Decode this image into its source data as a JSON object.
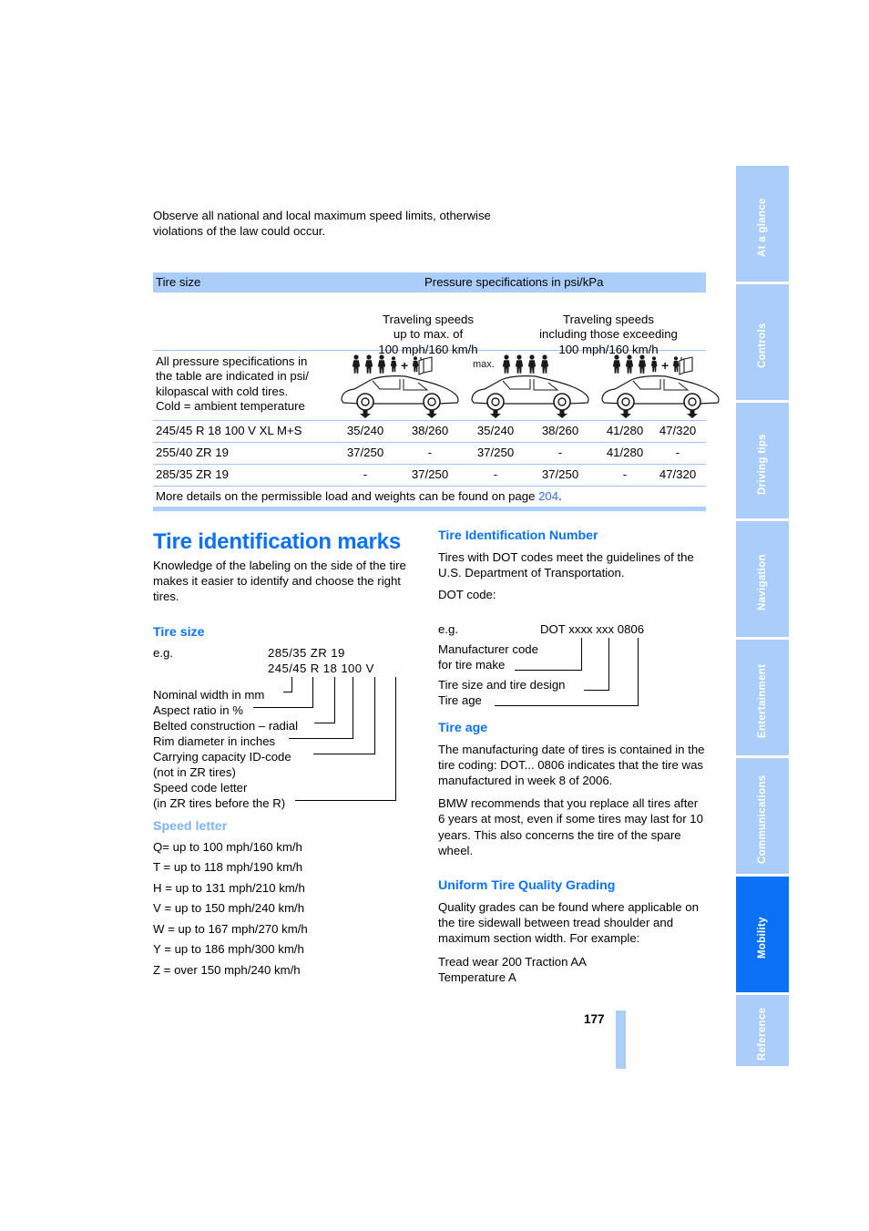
{
  "intro": {
    "text": "Observe all national and local maximum speed limits, otherwise violations of the law could occur."
  },
  "pressure_table": {
    "header_left": "Tire size",
    "header_right": "Pressure specifications in psi/kPa",
    "subheader_left": "Traveling speeds\nup to max. of\n100 mph/160 km/h",
    "subheader_right": "Traveling speeds\nincluding those exceeding\n100 mph/160 km/h",
    "note": "All pressure specifications in the table are indicated in psi/ kilopascal with cold tires.\nCold = ambient temperature",
    "loading_icons": [
      {
        "name": "car-four-persons-plus-luggage",
        "max_prefix": "",
        "persons": 4,
        "plus_person": true,
        "luggage": true
      },
      {
        "name": "car-max-four-persons",
        "max_prefix": "max.",
        "persons": 4,
        "plus_person": false,
        "luggage": false
      },
      {
        "name": "car-four-persons-plus-luggage",
        "max_prefix": "",
        "persons": 4,
        "plus_person": true,
        "luggage": true
      }
    ],
    "rows": [
      {
        "tire_size": "245/45 R 18 100 V XL M+S",
        "values": [
          "35/240",
          "38/260",
          "35/240",
          "38/260",
          "41/280",
          "47/320"
        ]
      },
      {
        "tire_size": "255/40 ZR 19",
        "values": [
          "37/250",
          "-",
          "37/250",
          "-",
          "41/280",
          "-"
        ]
      },
      {
        "tire_size": "285/35 ZR 19",
        "values": [
          "-",
          "37/250",
          "-",
          "37/250",
          "-",
          "47/320"
        ]
      }
    ],
    "footer_prefix": "More details on the permissible load and weights can be found on page ",
    "footer_page": "204",
    "footer_suffix": "."
  },
  "section": {
    "title": "Tire identification marks",
    "intro": "Knowledge of the labeling on the side of the tire makes it easier to identify and choose the right tires."
  },
  "tire_size": {
    "heading": "Tire size",
    "eg_label": "e.g.",
    "code_line1": "285/35  ZR 19",
    "code_line2": "245/45  R  18 100  V",
    "legend": [
      "Nominal width in mm",
      "Aspect ratio in %",
      "Belted construction – radial",
      "Rim diameter in inches",
      "Carrying capacity ID-code",
      "(not in ZR tires)",
      "Speed code letter",
      "(in ZR tires before the R)"
    ]
  },
  "speed_letter": {
    "heading": "Speed letter",
    "rows": [
      "Q= up to 100 mph/160 km/h",
      "T = up to 118 mph/190 km/h",
      "H = up to 131 mph/210 km/h",
      "V = up to 150 mph/240 km/h",
      "W = up to 167 mph/270 km/h",
      "Y = up to 186 mph/300 km/h",
      "Z = over 150 mph/240 km/h"
    ]
  },
  "tin": {
    "heading": "Tire Identification Number",
    "body": "Tires with DOT codes meet the guidelines of the U.S. Department of Transportation.",
    "dot_code_label": "DOT code:",
    "eg_label": "e.g.",
    "dot_code": "DOT xxxx xxx 0806",
    "legend": [
      "Manufacturer code",
      "for tire make",
      "Tire size and tire design",
      "Tire age"
    ]
  },
  "tire_age": {
    "heading": "Tire age",
    "paragraph1": "The manufacturing date of tires is contained in the tire coding: DOT... 0806 indicates that the tire was manufactured in week 8 of 2006.",
    "paragraph2": "BMW recommends that you replace all tires after 6 years at most, even if some tires may last for 10 years. This also concerns the tire of the spare wheel."
  },
  "utqg": {
    "heading": "Uniform Tire Quality Grading",
    "paragraph": "Quality grades can be found where applicable on the tire sidewall between tread shoulder and maximum section width. For example:",
    "example_line1": "Tread wear 200 Traction AA",
    "example_line2": "Temperature A"
  },
  "tabs": [
    {
      "label": "At a glance",
      "active": false
    },
    {
      "label": "Controls",
      "active": false
    },
    {
      "label": "Driving tips",
      "active": false
    },
    {
      "label": "Navigation",
      "active": false
    },
    {
      "label": "Entertainment",
      "active": false
    },
    {
      "label": "Communications",
      "active": false
    },
    {
      "label": "Mobility",
      "active": true
    },
    {
      "label": "Reference",
      "active": false
    }
  ],
  "page_number": "177",
  "colors": {
    "accent_blue": "#0b72f7",
    "pale_blue": "#aacdfa",
    "link_blue": "#2f6ff0"
  }
}
